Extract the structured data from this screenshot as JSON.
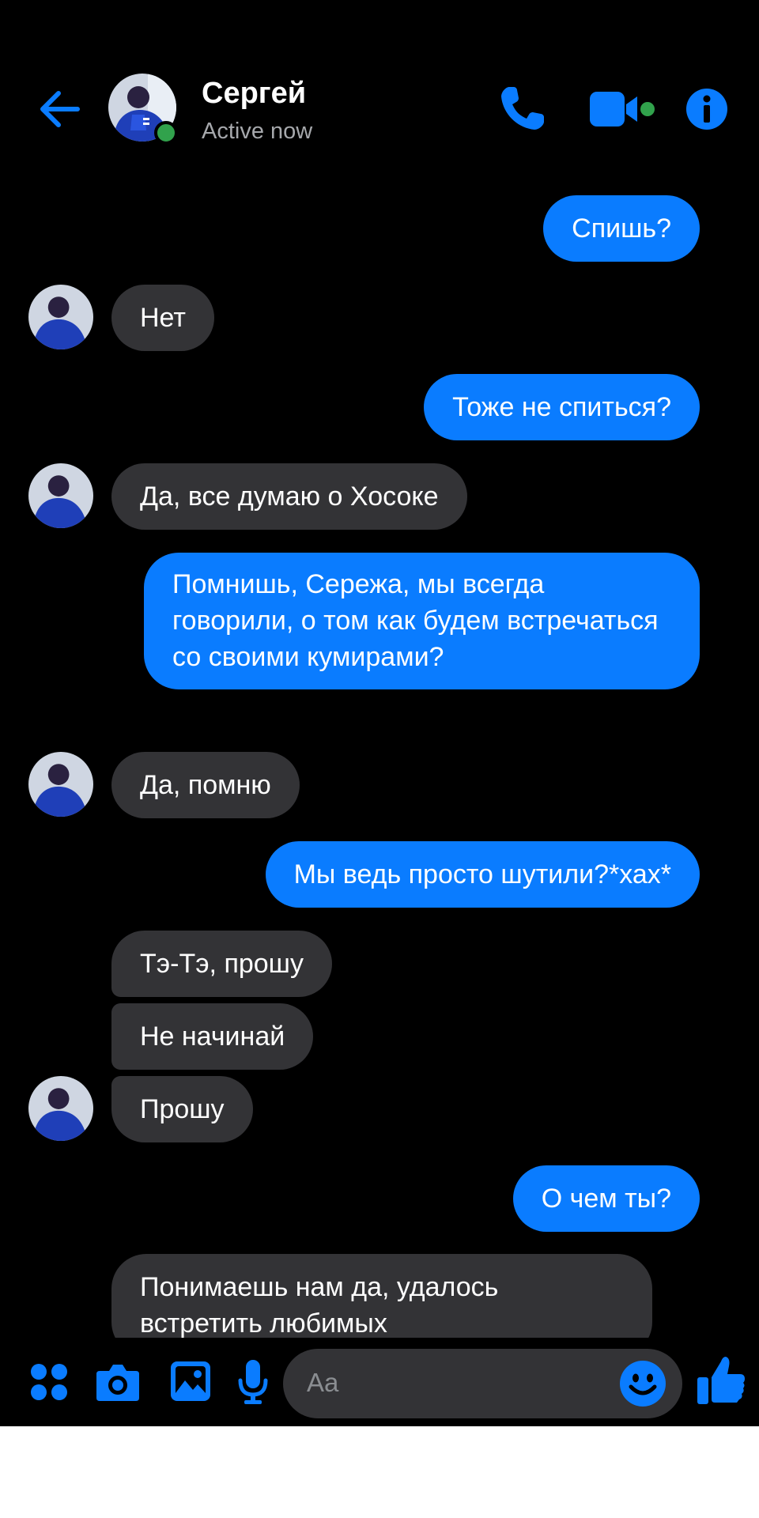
{
  "header": {
    "back_icon": "arrow-left-icon",
    "contact_name": "Сергей",
    "contact_status": "Active now",
    "call_icon": "phone-icon",
    "video_icon": "video-camera-icon",
    "info_icon": "info-icon"
  },
  "messages": [
    {
      "direction": "out",
      "text": "Спишь?"
    },
    {
      "direction": "in",
      "text": "Нет"
    },
    {
      "direction": "out",
      "text": "Тоже не спиться?"
    },
    {
      "direction": "in",
      "text": "Да, все думаю о Хосоке"
    },
    {
      "direction": "out",
      "text": "Помнишь, Сережа,  мы всегда говорили, о том как будем встречаться со своими кумирами?"
    },
    {
      "direction": "in",
      "text": "Да, помню"
    },
    {
      "direction": "out",
      "text": "Мы ведь просто шутили?*хах*"
    },
    {
      "direction": "in",
      "text": "Тэ-Тэ, прошу"
    },
    {
      "direction": "in",
      "text": "Не начинай"
    },
    {
      "direction": "in",
      "text": "Прошу"
    },
    {
      "direction": "out",
      "text": "О чем ты?"
    },
    {
      "direction": "in",
      "text": "Понимаешь нам да, удалось встретить любимых"
    }
  ],
  "composer": {
    "placeholder": "Aa",
    "icons": [
      "apps-grid-icon",
      "camera-icon",
      "image-icon",
      "microphone-icon",
      "emoji-icon",
      "thumbs-up-icon"
    ]
  },
  "colors": {
    "background": "#000000",
    "accent": "#0a7cff",
    "incoming_bubble": "#333336",
    "online": "#31a24c",
    "secondary_text": "#a6a8ac"
  }
}
